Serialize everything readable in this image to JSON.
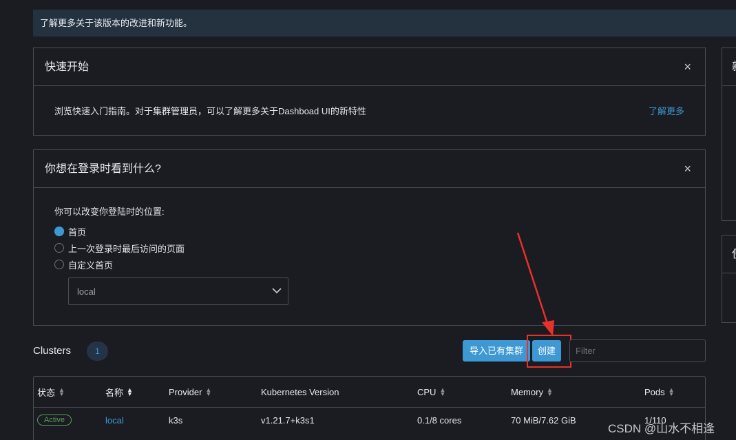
{
  "banner": {
    "text": "了解更多关于该版本的改进和新功能。"
  },
  "quick_start": {
    "title": "快速开始",
    "close": "×",
    "body": "浏览快速入门指南。对于集群管理员，可以了解更多关于Dashboad UI的新特性",
    "learn_more": "了解更多"
  },
  "login_pref": {
    "title": "你想在登录时看到什么?",
    "close": "×",
    "prompt": "你可以改变你登陆时的位置:",
    "options": [
      {
        "label": "首页",
        "selected": true
      },
      {
        "label": "上一次登录时最后访问的页面",
        "selected": false
      },
      {
        "label": "自定义首页",
        "selected": false
      }
    ],
    "select_value": "local"
  },
  "side_cards": [
    {
      "title": "新"
    },
    {
      "title": "使"
    }
  ],
  "clusters": {
    "title": "Clusters",
    "count": "1",
    "import_button": "导入已有集群",
    "create_button": "创建",
    "filter_placeholder": "Filter",
    "columns": [
      "状态",
      "名称",
      "Provider",
      "Kubernetes Version",
      "CPU",
      "Memory",
      "Pods"
    ],
    "rows": [
      {
        "status": "Active",
        "name": "local",
        "provider": "k3s",
        "version": "v1.21.7+k3s1",
        "cpu": "0.1/8 cores",
        "memory": "70 MiB/7.62 GiB",
        "pods": "1/110"
      }
    ]
  },
  "watermark": "CSDN @山水不相逢",
  "colors": {
    "accent": "#3d98d3",
    "banner_bg": "#24323f",
    "annotation": "#e8312a",
    "active": "#5a9e5e"
  }
}
